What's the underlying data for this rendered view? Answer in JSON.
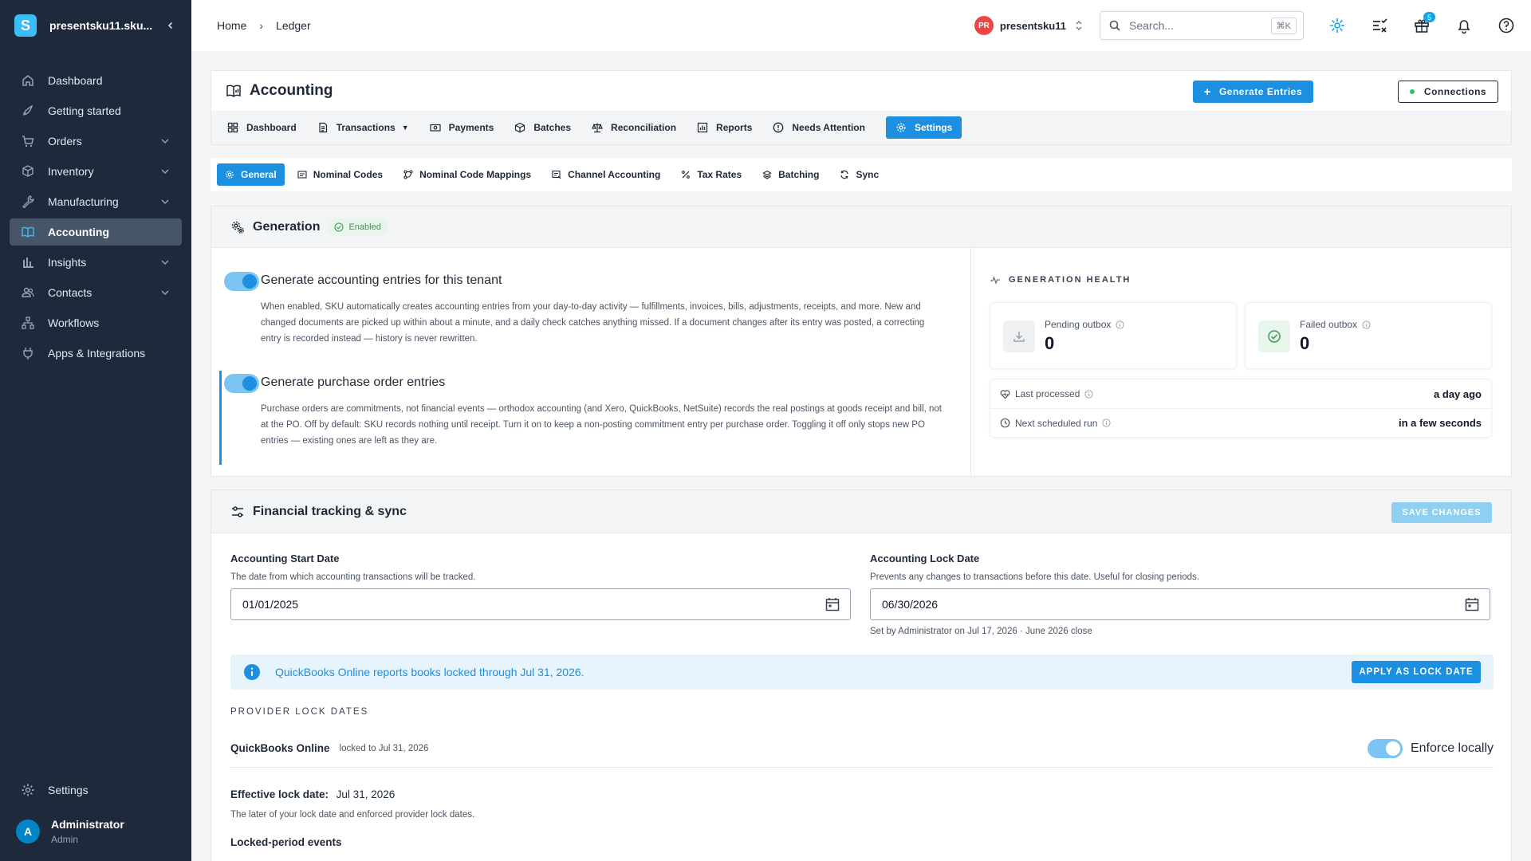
{
  "sidebar": {
    "tenant_name": "presentsku11.sku...",
    "logo_letter": "S",
    "items": [
      {
        "label": "Dashboard",
        "icon": "home-icon",
        "expandable": false,
        "active": false
      },
      {
        "label": "Getting started",
        "icon": "rocket-icon",
        "expandable": false,
        "active": false
      },
      {
        "label": "Orders",
        "icon": "cart-icon",
        "expandable": true,
        "active": false
      },
      {
        "label": "Inventory",
        "icon": "box-icon",
        "expandable": true,
        "active": false
      },
      {
        "label": "Manufacturing",
        "icon": "wrench-icon",
        "expandable": true,
        "active": false
      },
      {
        "label": "Accounting",
        "icon": "ledger-icon",
        "expandable": false,
        "active": true
      },
      {
        "label": "Insights",
        "icon": "bar-chart-icon",
        "expandable": true,
        "active": false
      },
      {
        "label": "Contacts",
        "icon": "people-icon",
        "expandable": true,
        "active": false
      },
      {
        "label": "Workflows",
        "icon": "workflow-icon",
        "expandable": false,
        "active": false
      },
      {
        "label": "Apps & Integrations",
        "icon": "plug-icon",
        "expandable": false,
        "active": false
      }
    ],
    "settings_label": "Settings",
    "user": {
      "initial": "A",
      "name": "Administrator",
      "role": "Admin"
    }
  },
  "topbar": {
    "breadcrumbs": [
      "Home",
      "Ledger"
    ],
    "tenant": {
      "initials": "PR",
      "name": "presentsku11"
    },
    "search": {
      "placeholder": "Search...",
      "shortcut": "⌘K"
    },
    "notifications_badge": "5"
  },
  "accounting": {
    "title": "Accounting",
    "generate_button": "Generate Entries",
    "connections_button": "Connections",
    "tabs": [
      {
        "label": "Dashboard",
        "icon": "dashboard-icon",
        "active": false,
        "caret": false
      },
      {
        "label": "Transactions",
        "icon": "document-icon",
        "active": false,
        "caret": true
      },
      {
        "label": "Payments",
        "icon": "payments-icon",
        "active": false,
        "caret": false
      },
      {
        "label": "Batches",
        "icon": "batches-icon",
        "active": false,
        "caret": false
      },
      {
        "label": "Reconciliation",
        "icon": "scale-icon",
        "active": false,
        "caret": false
      },
      {
        "label": "Reports",
        "icon": "report-icon",
        "active": false,
        "caret": false
      },
      {
        "label": "Needs Attention",
        "icon": "alert-circle-icon",
        "active": false,
        "caret": false
      },
      {
        "label": "Settings",
        "icon": "gear-icon",
        "active": true,
        "caret": false
      }
    ],
    "subtabs": [
      {
        "label": "General",
        "icon": "gear-icon",
        "active": true
      },
      {
        "label": "Nominal Codes",
        "icon": "list-icon",
        "active": false
      },
      {
        "label": "Nominal Code Mappings",
        "icon": "mapping-icon",
        "active": false
      },
      {
        "label": "Channel Accounting",
        "icon": "channel-icon",
        "active": false
      },
      {
        "label": "Tax Rates",
        "icon": "percent-icon",
        "active": false
      },
      {
        "label": "Batching",
        "icon": "layers-icon",
        "active": false
      },
      {
        "label": "Sync",
        "icon": "sync-icon",
        "active": false
      }
    ]
  },
  "generation": {
    "title": "Generation",
    "status_badge": "Enabled",
    "options": [
      {
        "title": "Generate accounting entries for this tenant",
        "enabled": true,
        "description": "When enabled, SKU automatically creates accounting entries from your day-to-day activity — fulfillments, invoices, bills, adjustments, receipts, and more. New and changed documents are picked up within about a minute, and a daily check catches anything missed. If a document changes after its entry was posted, a correcting entry is recorded instead — history is never rewritten."
      },
      {
        "title": "Generate purchase order entries",
        "enabled": true,
        "description": "Purchase orders are commitments, not financial events — orthodox accounting (and Xero, QuickBooks, NetSuite) records the real postings at goods receipt and bill, not at the PO. Off by default: SKU records nothing until receipt. Turn it on to keep a non-posting commitment entry per purchase order. Toggling it off only stops new PO entries — existing ones are left as they are."
      }
    ],
    "health": {
      "title": "GENERATION HEALTH",
      "pending_label": "Pending outbox",
      "pending_value": "0",
      "failed_label": "Failed outbox",
      "failed_value": "0",
      "last_processed_label": "Last processed",
      "last_processed_value": "a day ago",
      "next_run_label": "Next scheduled run",
      "next_run_value": "in a few seconds"
    }
  },
  "financial": {
    "title": "Financial tracking & sync",
    "save_button": "SAVE CHANGES",
    "start_date": {
      "label": "Accounting Start Date",
      "help": "The date from which accounting transactions will be tracked.",
      "value": "01/01/2025"
    },
    "lock_date": {
      "label": "Accounting Lock Date",
      "help": "Prevents any changes to transactions before this date. Useful for closing periods.",
      "value": "06/30/2026",
      "note": "Set by Administrator on Jul 17, 2026 · June 2026 close"
    },
    "banner": {
      "message": "QuickBooks Online reports books locked through Jul 31, 2026.",
      "button": "APPLY AS LOCK DATE"
    },
    "provider_lock_title": "PROVIDER LOCK DATES",
    "provider": {
      "name": "QuickBooks Online",
      "locked_text": "locked to Jul 31, 2026",
      "toggle_label": "Enforce locally",
      "enforce": true
    },
    "effective_label": "Effective lock date:",
    "effective_value": "Jul 31, 2026",
    "effective_help": "The later of your lock date and enforced provider lock dates.",
    "locked_events_title": "Locked-period events"
  },
  "colors": {
    "sidebar_bg": "#1e293b",
    "accent": "#1d8fe1",
    "success": "#3f9b57",
    "danger_avatar": "#ef4444"
  }
}
